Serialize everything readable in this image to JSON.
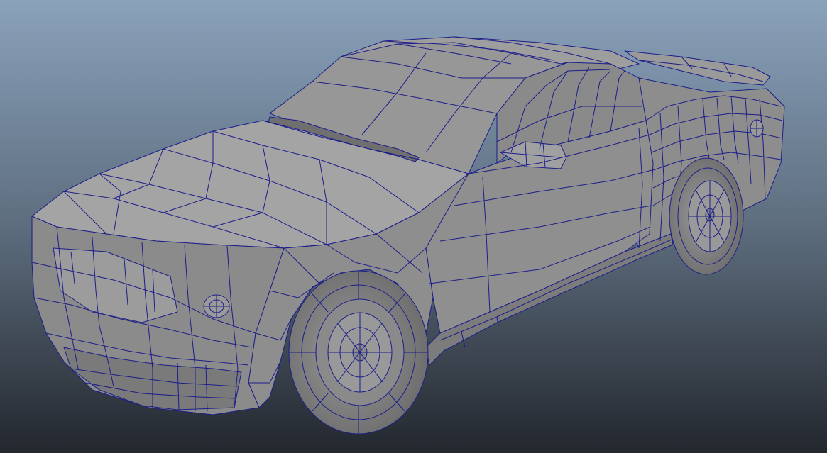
{
  "viewport": {
    "background_top": "#8aa2bb",
    "background_bottom": "#23272e",
    "wire_color": "#1c1e8a",
    "shade_light": "#a6a6a6",
    "shade_mid": "#8f8f8f",
    "shade_dark": "#6b6b6b",
    "tire_color": "#7e7e7e",
    "subject": "wireframe-car-model"
  }
}
